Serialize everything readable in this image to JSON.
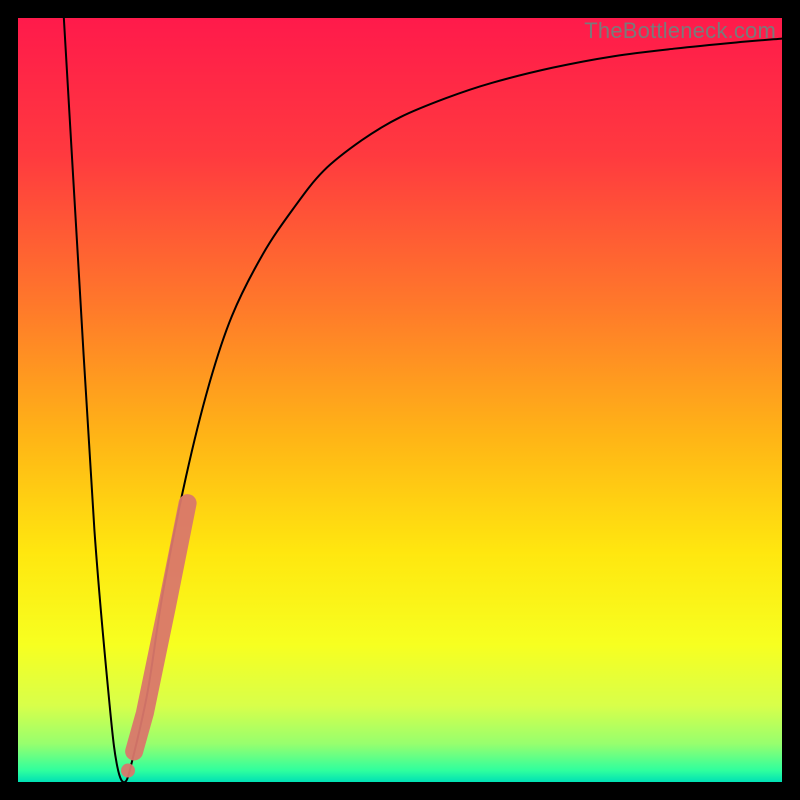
{
  "watermark": "TheBottleneck.com",
  "chart_data": {
    "type": "line",
    "title": "",
    "xlabel": "",
    "ylabel": "",
    "xlim": [
      0,
      100
    ],
    "ylim": [
      0,
      100
    ],
    "grid": false,
    "legend": false,
    "gradient_stops": [
      {
        "offset": 0.0,
        "color": "#ff1a4b"
      },
      {
        "offset": 0.18,
        "color": "#ff3a3f"
      },
      {
        "offset": 0.38,
        "color": "#ff7a2a"
      },
      {
        "offset": 0.55,
        "color": "#ffb516"
      },
      {
        "offset": 0.7,
        "color": "#ffe70f"
      },
      {
        "offset": 0.82,
        "color": "#f7ff20"
      },
      {
        "offset": 0.9,
        "color": "#d8ff4a"
      },
      {
        "offset": 0.95,
        "color": "#97ff6e"
      },
      {
        "offset": 0.985,
        "color": "#2fff9e"
      },
      {
        "offset": 1.0,
        "color": "#00e0b5"
      }
    ],
    "series": [
      {
        "name": "bottleneck-curve",
        "x": [
          6,
          8,
          10,
          12,
          13,
          14,
          15,
          17,
          19,
          22,
          25,
          28,
          32,
          36,
          40,
          45,
          50,
          56,
          62,
          70,
          78,
          86,
          94,
          100
        ],
        "y": [
          100,
          66,
          33,
          10,
          2,
          0,
          3,
          12,
          25,
          40,
          52,
          61,
          69,
          75,
          80,
          84,
          87,
          89.5,
          91.5,
          93.5,
          95,
          96,
          96.8,
          97.3
        ]
      }
    ],
    "marker_segment": {
      "name": "highlight",
      "color": "#d9776b",
      "points": [
        {
          "x": 14.4,
          "y": 1.5
        },
        {
          "x": 15.2,
          "y": 4.0
        },
        {
          "x": 16.6,
          "y": 9.0
        },
        {
          "x": 19.5,
          "y": 23.0
        },
        {
          "x": 22.2,
          "y": 36.5
        }
      ]
    }
  }
}
